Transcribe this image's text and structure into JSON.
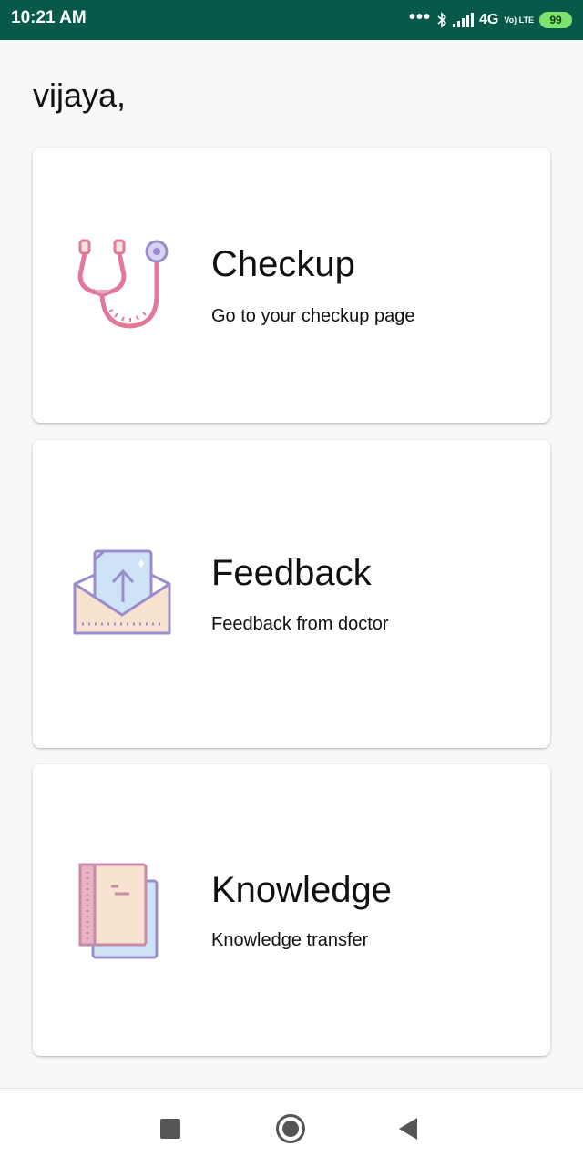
{
  "status_bar": {
    "time": "10:21 AM",
    "network": "4G",
    "volte": "Vo) LTE",
    "battery": "99"
  },
  "greeting": "vijaya,",
  "cards": [
    {
      "title": "Checkup",
      "subtitle": "Go to your checkup page",
      "icon": "stethoscope-icon"
    },
    {
      "title": "Feedback",
      "subtitle": "Feedback from doctor",
      "icon": "envelope-upload-icon"
    },
    {
      "title": "Knowledge",
      "subtitle": "Knowledge transfer",
      "icon": "books-icon"
    }
  ],
  "nav": {
    "recents_icon": "square-icon",
    "home_icon": "circle-icon",
    "back_icon": "triangle-back-icon"
  },
  "colors": {
    "status_bar": "#075a4a",
    "battery": "#7ee36a",
    "icon_pink": "#e07a98",
    "icon_purple": "#9b8ccc"
  }
}
